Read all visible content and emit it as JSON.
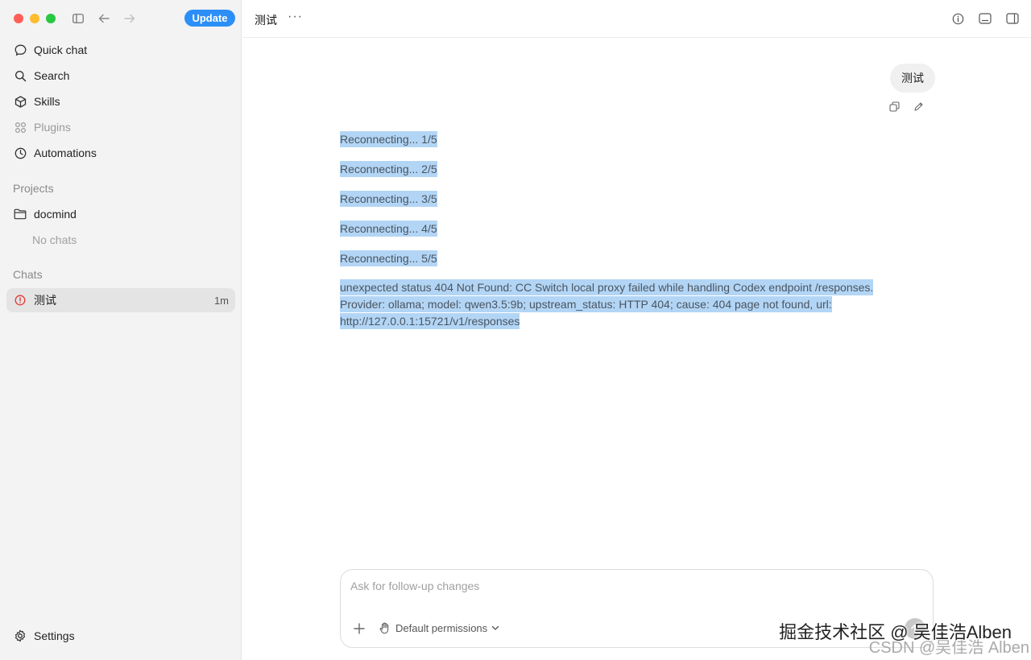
{
  "sidebar": {
    "update_label": "Update",
    "nav": [
      {
        "label": "Quick chat",
        "icon": "chat-bubble-icon"
      },
      {
        "label": "Search",
        "icon": "search-icon"
      },
      {
        "label": "Skills",
        "icon": "cube-icon"
      },
      {
        "label": "Plugins",
        "icon": "grid-icon"
      },
      {
        "label": "Automations",
        "icon": "clock-icon"
      }
    ],
    "projects_label": "Projects",
    "project": {
      "label": "docmind",
      "icon": "folder-icon"
    },
    "no_chats": "No chats",
    "chats_label": "Chats",
    "chat": {
      "label": "测试",
      "time": "1m",
      "icon": "error-icon"
    },
    "settings_label": "Settings"
  },
  "main": {
    "title": "测试",
    "more": "···",
    "user_message": "测试",
    "lines": [
      "Reconnecting... 1/5",
      "Reconnecting... 2/5",
      "Reconnecting... 3/5",
      "Reconnecting... 4/5",
      "Reconnecting... 5/5"
    ],
    "error": "unexpected status 404 Not Found: CC Switch local proxy failed while handling Codex endpoint /responses. Provider: ollama; model: qwen3.5:9b; upstream_status: HTTP 404; cause: 404 page not found, url: http://127.0.0.1:15721/v1/responses"
  },
  "composer": {
    "placeholder": "Ask for follow-up changes",
    "permissions_label": "Default permissions"
  },
  "watermark": {
    "line1": "掘金技术社区 @ 吴佳浩Alben",
    "line2": "CSDN @吴佳浩 Alben"
  },
  "colors": {
    "accent": "#2b8ff7",
    "selection": "#b3d5f5",
    "error": "#e53935"
  }
}
